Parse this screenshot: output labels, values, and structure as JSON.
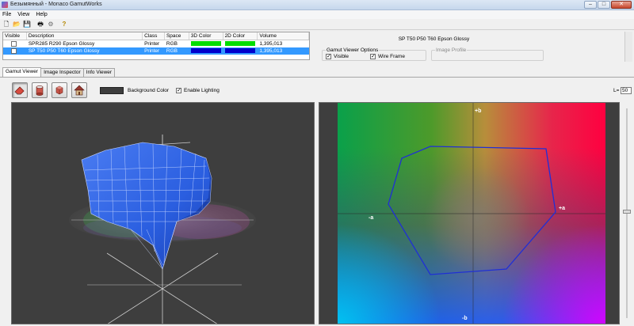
{
  "window": {
    "title": "Безымянный - Monaco GamutWorks",
    "minimize": "–",
    "maximize": "□",
    "close": "✕"
  },
  "menu": [
    "File",
    "View",
    "Help"
  ],
  "toolbar": [
    {
      "name": "new-icon",
      "glyph": "🗋"
    },
    {
      "name": "open-folder-icon",
      "glyph": "📂"
    },
    {
      "name": "save-icon",
      "glyph": "💾"
    },
    {
      "name": "print-icon",
      "glyph": "🖶"
    },
    {
      "name": "gear-icon",
      "glyph": "⚙"
    },
    {
      "name": "help-icon",
      "glyph": "?"
    }
  ],
  "profiles": {
    "columns": [
      "Visible",
      "Description",
      "Class",
      "Space",
      "3D Color",
      "2D Color",
      "Volume"
    ],
    "rows": [
      {
        "description": "SPR285 R290 Epson Glossy",
        "class": "Printer",
        "space": "RGB",
        "color3d": "#00dd00",
        "color2d": "#00dd00",
        "volume": "1,395,013",
        "selected": false
      },
      {
        "description": "SP T50 P50 T60 Epson Glossy",
        "class": "Printer",
        "space": "RGB",
        "color3d": "#0000cc",
        "color2d": "#0000cc",
        "volume": "1,395,013",
        "selected": true
      }
    ]
  },
  "viewer_options": {
    "profile_title": "SP T50 P50 T60 Epson Glossy",
    "group_label": "Gamut Viewer Options",
    "visible_label": "Visible",
    "wireframe_label": "Wire Frame",
    "image_profile_label": "Image Profile",
    "check_mark": "✓"
  },
  "tabs": [
    "Gamut Viewer",
    "Image Inspector",
    "Info Viewer"
  ],
  "view_controls": {
    "background_color_label": "Background Color",
    "enable_lighting_label": "Enable Lighting",
    "l_label": "L=",
    "l_value": "50"
  },
  "plot": {
    "plus_b": "+b",
    "minus_b": "-b",
    "plus_a": "+a",
    "minus_a": "-a"
  }
}
